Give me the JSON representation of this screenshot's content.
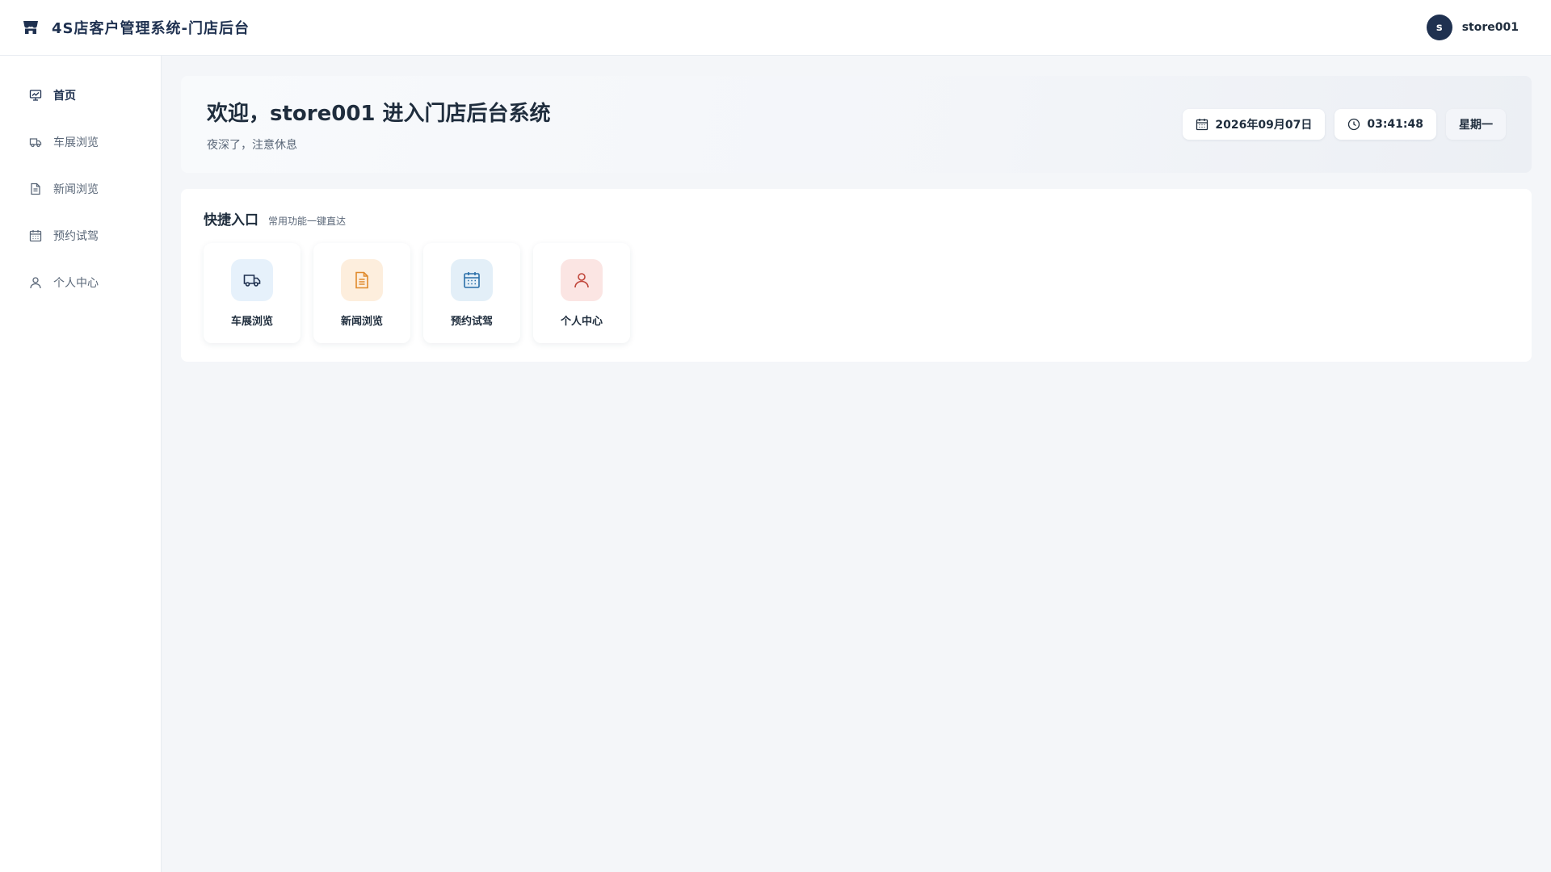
{
  "header": {
    "title": "4S店客户管理系统-门店后台",
    "avatar_letter": "s",
    "username": "store001"
  },
  "sidebar": {
    "items": [
      {
        "label": "首页",
        "icon": "dashboard-icon",
        "active": true
      },
      {
        "label": "车展浏览",
        "icon": "truck-icon"
      },
      {
        "label": "新闻浏览",
        "icon": "document-icon"
      },
      {
        "label": "预约试驾",
        "icon": "calendar-icon"
      },
      {
        "label": "个人中心",
        "icon": "user-icon"
      }
    ]
  },
  "welcome": {
    "title": "欢迎，store001 进入门店后台系统",
    "subtitle": "夜深了，注意休息",
    "date": "2026年09月07日",
    "time": "03:41:48",
    "weekday": "星期一"
  },
  "quick": {
    "title": "快捷入口",
    "subtitle": "常用功能一键直达",
    "cards": [
      {
        "label": "车展浏览",
        "icon": "truck-icon",
        "bg": "#e6f1fb",
        "color": "#1f3150"
      },
      {
        "label": "新闻浏览",
        "icon": "document-icon",
        "bg": "#fdeedd",
        "color": "#e08a2c"
      },
      {
        "label": "预约试驾",
        "icon": "calendar-icon",
        "bg": "#e3eff8",
        "color": "#2a6fa8"
      },
      {
        "label": "个人中心",
        "icon": "user-icon",
        "bg": "#fbe5e3",
        "color": "#c0453a"
      }
    ]
  },
  "colors": {
    "brand": "#1f3150",
    "text": "#1f2d3d",
    "muted": "#5a6778",
    "background": "#f4f6f9"
  }
}
